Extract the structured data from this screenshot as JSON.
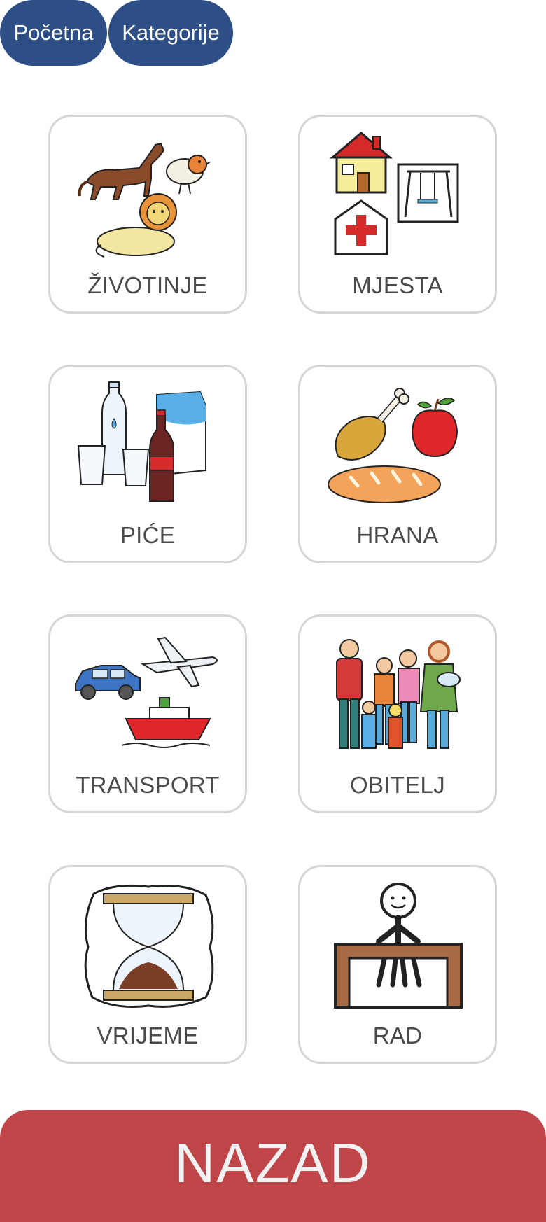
{
  "nav": {
    "home_label": "Početna",
    "categories_label": "Kategorije"
  },
  "tiles": [
    {
      "label": "ŽIVOTINJE",
      "icon": "animals-icon"
    },
    {
      "label": "MJESTA",
      "icon": "places-icon"
    },
    {
      "label": "PIĆE",
      "icon": "drinks-icon"
    },
    {
      "label": "HRANA",
      "icon": "food-icon"
    },
    {
      "label": "TRANSPORT",
      "icon": "transport-icon"
    },
    {
      "label": "OBITELJ",
      "icon": "family-icon"
    },
    {
      "label": "VRIJEME",
      "icon": "hourglass-icon"
    },
    {
      "label": "RAD",
      "icon": "work-icon"
    }
  ],
  "back_button": {
    "label": "NAZAD"
  },
  "colors": {
    "nav": "#2d4f86",
    "back": "#bf4549",
    "tile_border": "#d6d6d6"
  }
}
